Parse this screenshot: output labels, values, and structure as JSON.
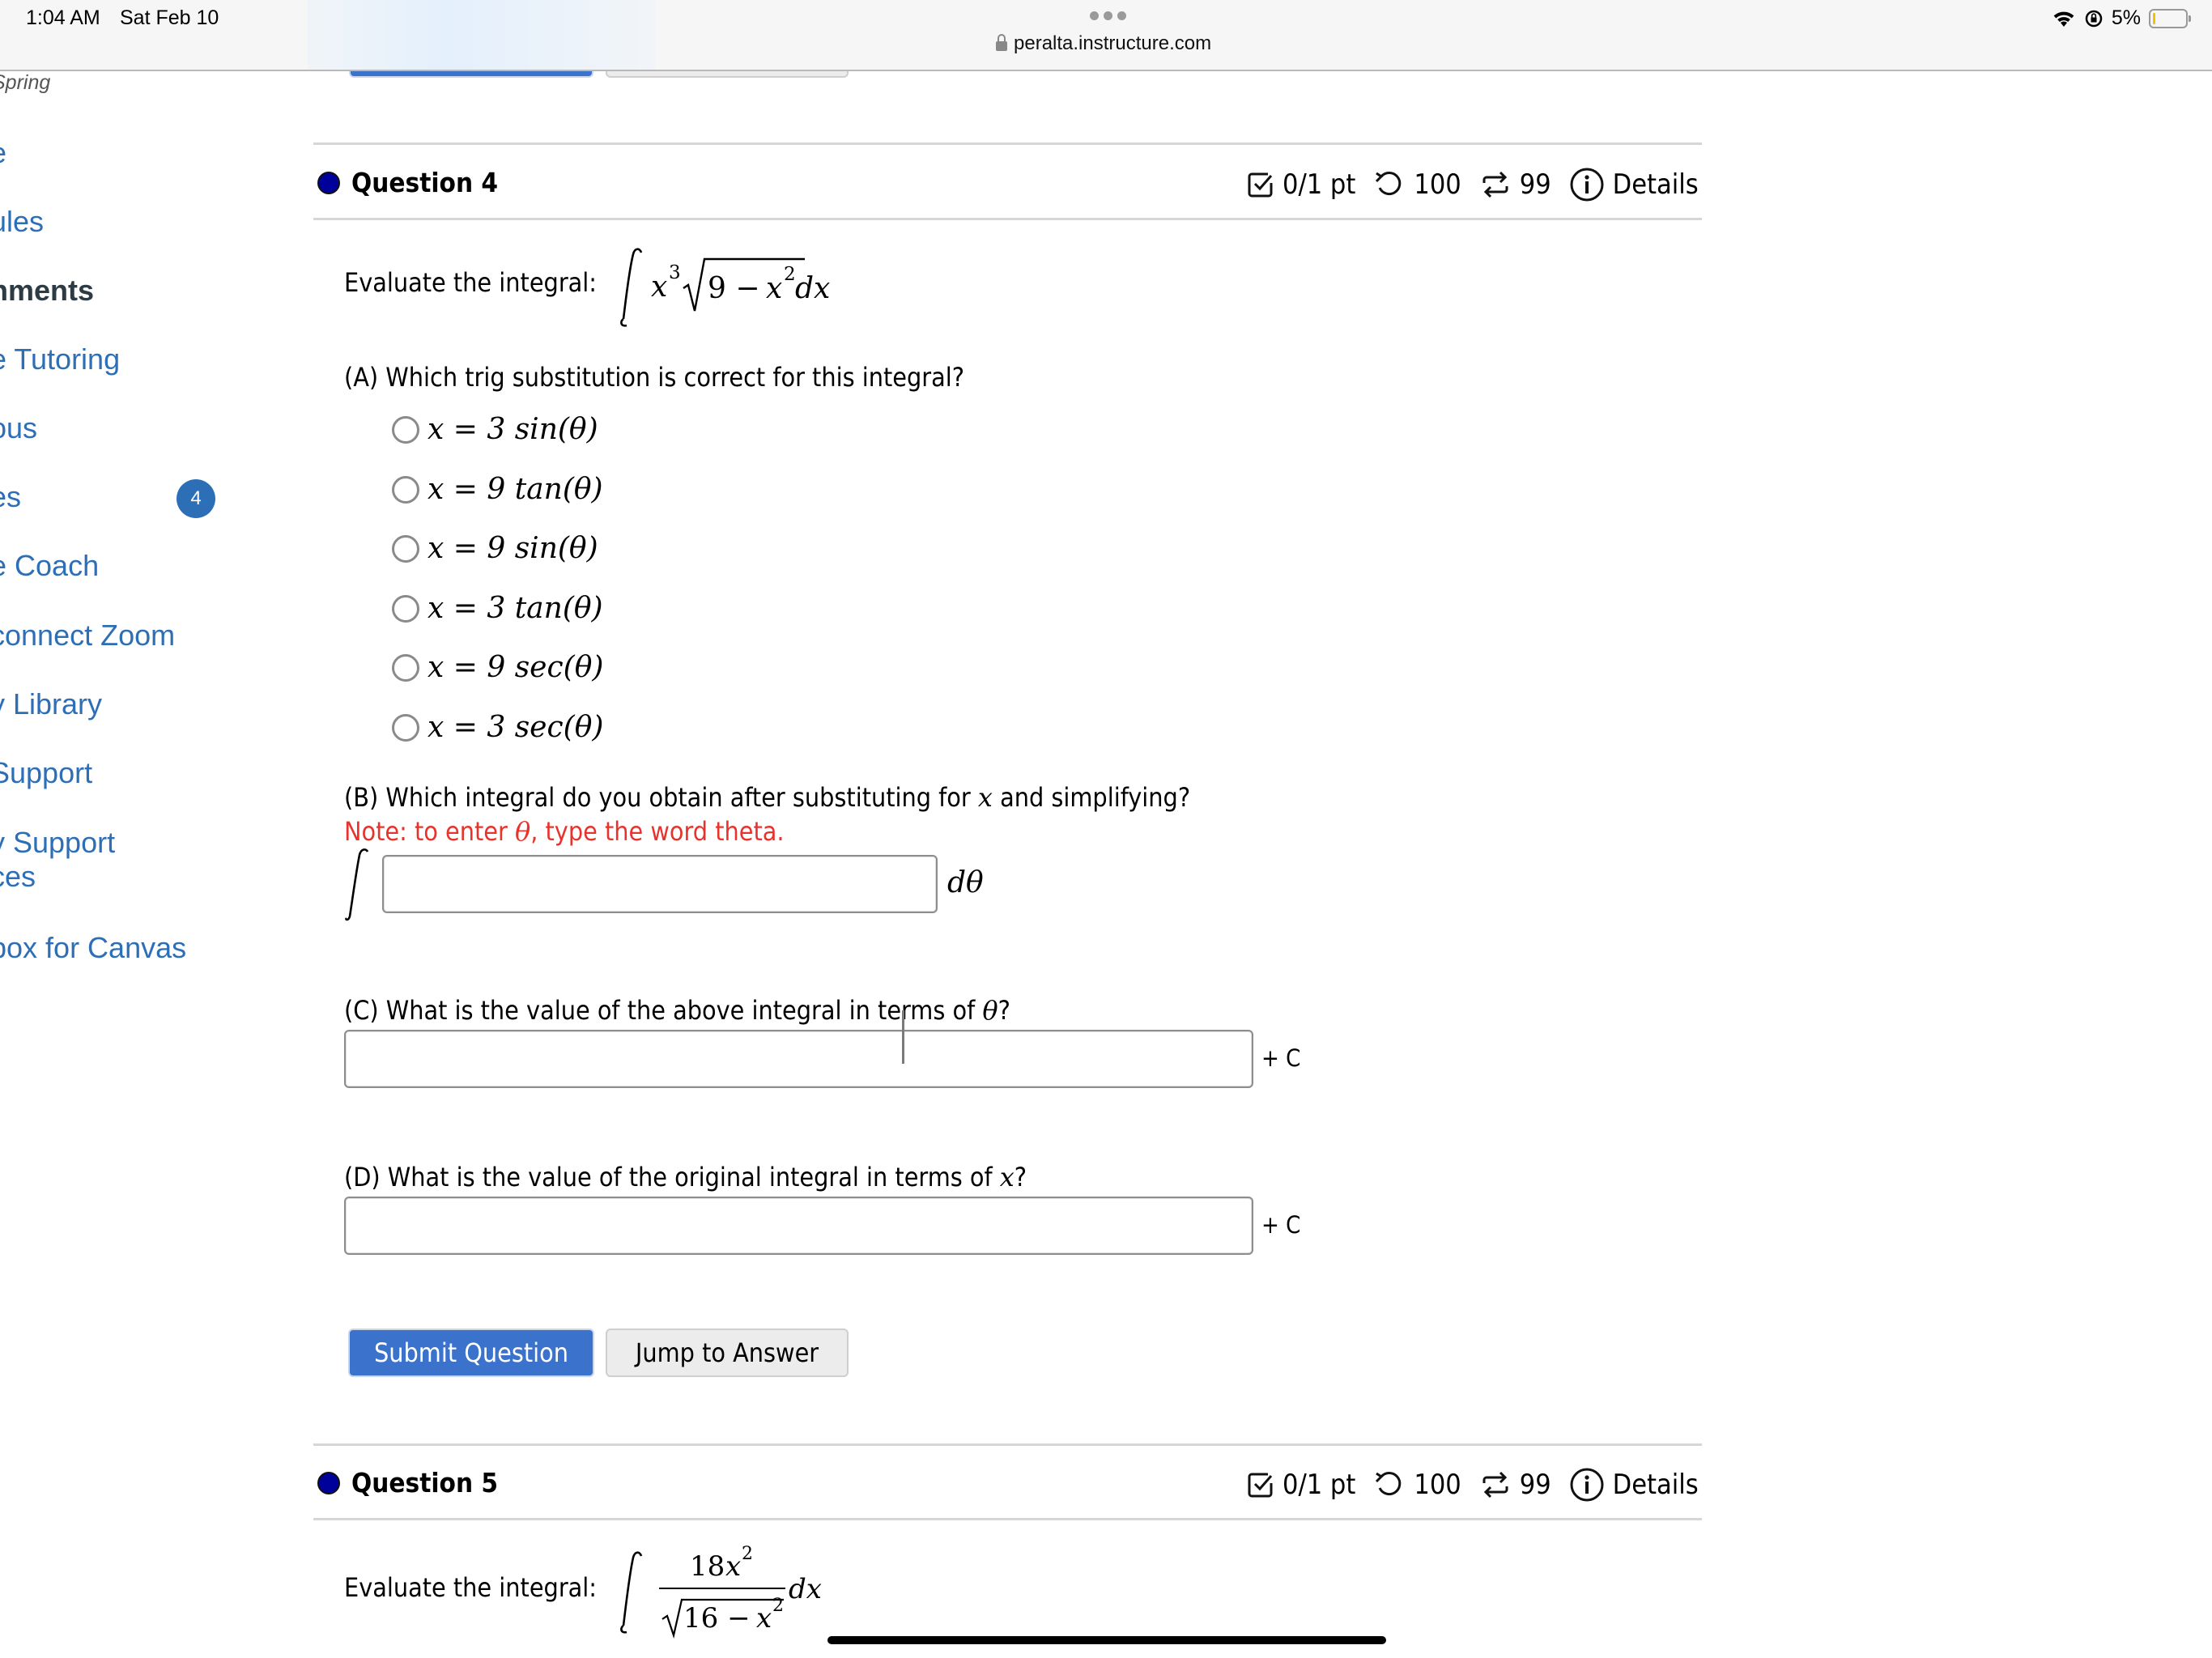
{
  "status_bar": {
    "time": "1:04 AM",
    "date": "Sat Feb 10",
    "url": "peralta.instructure.com",
    "battery_percent": "5%",
    "icons": [
      "wifi-icon",
      "orientation-lock-icon",
      "battery-icon"
    ]
  },
  "sidebar": {
    "term": "Spring",
    "items": [
      {
        "label": "e"
      },
      {
        "label": "ules"
      },
      {
        "label": "nments",
        "active": true
      },
      {
        "label": "e Tutoring"
      },
      {
        "label": "ous"
      },
      {
        "label": "es",
        "badge": "4"
      },
      {
        "label": "e Coach"
      },
      {
        "label": "connect Zoom"
      },
      {
        "label": "y Library"
      },
      {
        "label": " Support"
      },
      {
        "label": "y Support"
      },
      {
        "label": "ces"
      },
      {
        "label": "box for Canvas"
      }
    ]
  },
  "colors": {
    "link_blue": "#2d6fb6",
    "primary_button": "#3a72cc",
    "question_dot": "#00009b",
    "note_red": "#e8332d"
  },
  "questions": [
    {
      "title": "Question 4",
      "meta": {
        "score": "0/1 pt",
        "retries": "100",
        "attempts": "99",
        "details_label": "Details"
      },
      "prompt_label": "Evaluate the integral:",
      "integrand": "x³√(9 − x²) dx",
      "part_a": {
        "prompt": "(A) Which trig substitution is correct for this integral?",
        "options": [
          {
            "coef": "3",
            "fn": "sin"
          },
          {
            "coef": "9",
            "fn": "tan"
          },
          {
            "coef": "9",
            "fn": "sin"
          },
          {
            "coef": "3",
            "fn": "tan"
          },
          {
            "coef": "9",
            "fn": "sec"
          },
          {
            "coef": "3",
            "fn": "sec"
          }
        ],
        "option_texts": [
          "x = 3 sin(θ)",
          "x = 9 tan(θ)",
          "x = 9 sin(θ)",
          "x = 3 tan(θ)",
          "x = 9 sec(θ)",
          "x = 3 sec(θ)"
        ]
      },
      "part_b": {
        "prompt_pre": "(B) Which integral do you obtain after substituting for ",
        "prompt_var": "x",
        "prompt_post": " and simplifying?",
        "note_pre": "Note: to enter ",
        "note_var": "θ",
        "note_post": ", type the word theta.",
        "integral_sign": "∫",
        "suffix": "dθ",
        "value": ""
      },
      "part_c": {
        "prompt_pre": "(C) What is the value of the above integral in terms of ",
        "prompt_var": "θ",
        "prompt_post": "?",
        "value": "",
        "suffix": "+ C"
      },
      "part_d": {
        "prompt_pre": "(D) What is the value of the original integral in terms of ",
        "prompt_var": "x",
        "prompt_post": "?",
        "value": "",
        "suffix": "+ C"
      },
      "buttons": {
        "submit": "Submit Question",
        "jump": "Jump to Answer"
      }
    },
    {
      "title": "Question 5",
      "meta": {
        "score": "0/1 pt",
        "retries": "100",
        "attempts": "99",
        "details_label": "Details"
      },
      "prompt_label": "Evaluate the integral:",
      "numerator": "18x²",
      "denominator": "√(16 − x²)",
      "differential": "dx"
    }
  ]
}
